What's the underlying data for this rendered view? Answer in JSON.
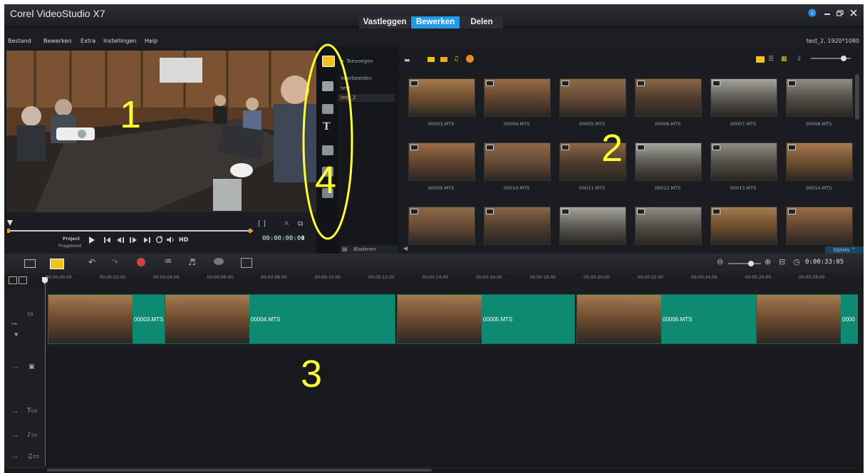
{
  "window": {
    "title": "Corel VideoStudio X7",
    "tabs": [
      "Vastleggen",
      "Bewerken",
      "Delen"
    ],
    "active_tab": "Bewerken",
    "controls": [
      "help-icon",
      "minimize-icon",
      "restore-icon",
      "close-icon"
    ]
  },
  "menu": {
    "items": [
      "Bestand",
      "Bewerken",
      "Extra",
      "Instellingen",
      "Help"
    ],
    "project_info": "test_2, 1920*1080"
  },
  "player": {
    "project_label": "Project",
    "fragment_label": "Fragment",
    "hd_label": "HD",
    "timecode": "00:00:00:00",
    "buttons": [
      "play-icon",
      "home-icon",
      "prev-frame-icon",
      "next-frame-icon",
      "end-icon",
      "repeat-icon",
      "volume-icon"
    ]
  },
  "library": {
    "add_label": "Toevoegen",
    "folders": [
      "Voorbeelden",
      "test",
      "test_2"
    ],
    "browse_label": "Bladeren",
    "options_label": "Opties",
    "clips": [
      "00003.MTS",
      "00004.MTS",
      "00005.MTS",
      "00006.MTS",
      "00007.MTS",
      "00008.MTS",
      "00009.MTS",
      "00010.MTS",
      "00011.MTS",
      "00012.MTS",
      "00013.MTS",
      "00014.MTS",
      "",
      "",
      "",
      "",
      "",
      ""
    ]
  },
  "timeline": {
    "duration": "0:00:33:05",
    "ticks": [
      "00:00:00:00",
      "00:00:02:00",
      "00:00:04:00",
      "00:00:06:00",
      "00:00:08:00",
      "00:00:10:00",
      "00:00:12:00",
      "00:00:14:00",
      "00:00:16:00",
      "00:00:18:00",
      "00:00:20:00",
      "00:00:22:00",
      "00:00:24:00",
      "00:00:26:00",
      "00:00:28:00"
    ],
    "clips": [
      "00003.MTS",
      "00004.MTS",
      "00005.MTS",
      "00006.MTS",
      "0000"
    ]
  },
  "annotations": [
    "1",
    "2",
    "3",
    "4"
  ],
  "colors": {
    "accent": "#1f9be8",
    "clip_teal": "#0f8a72",
    "annotation": "#ffff33"
  }
}
